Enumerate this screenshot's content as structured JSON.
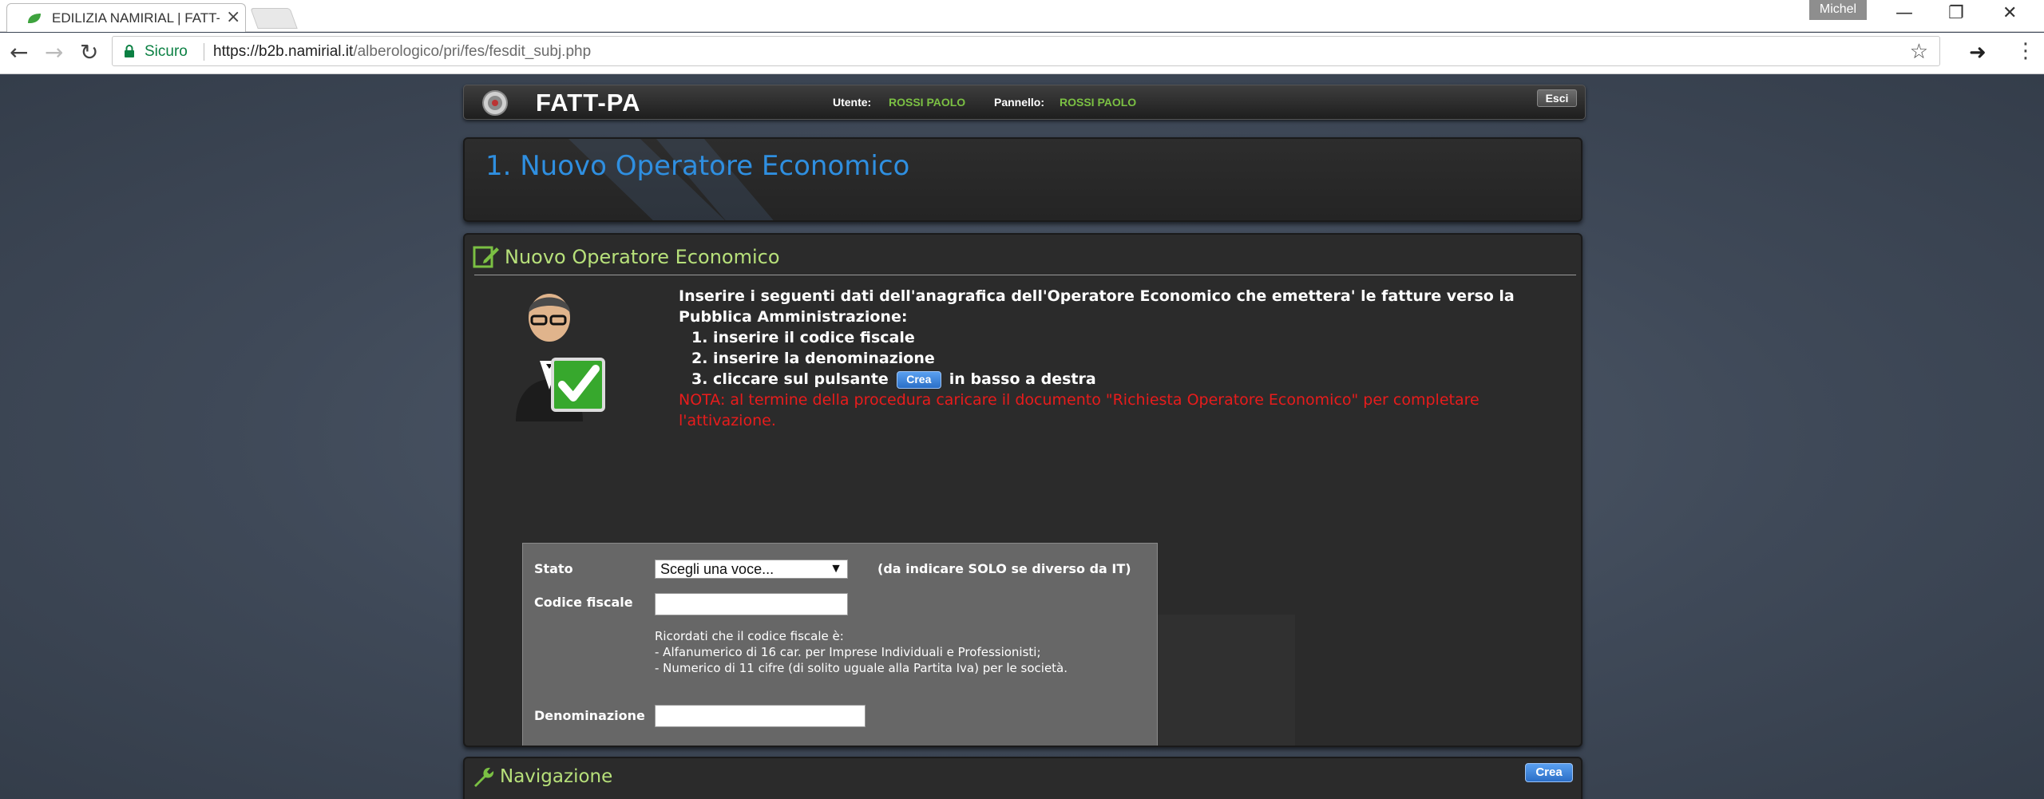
{
  "browser": {
    "tab_title": "EDILIZIA NAMIRIAL | FATT-PA",
    "tab_close": "×",
    "user_badge": "Michel",
    "secure_label": "Sicuro",
    "url_host": "https://b2b.namirial.it",
    "url_path": "/alberologico/pri/fes/fesdit_subj.php",
    "icons": [
      "back-arrow-icon",
      "forward-arrow-icon",
      "reload-icon",
      "lock-icon",
      "star-icon",
      "extension-arrow-icon",
      "menu-dots-icon"
    ]
  },
  "header": {
    "app_title": "FATT-PA",
    "utente_label": "Utente:",
    "utente_value": "ROSSI PAOLO",
    "pannello_label": "Pannello:",
    "pannello_value": "ROSSI PAOLO",
    "esci_label": "Esci"
  },
  "page_title": "1. Nuovo Operatore Economico",
  "main": {
    "section_title": "Nuovo Operatore Economico",
    "intro": "Inserire i seguenti dati dell'anagrafica dell'Operatore Economico che emettera' le fatture verso la Pubblica Amministrazione:",
    "steps": [
      "1. inserire il codice fiscale",
      "2. inserire la denominazione"
    ],
    "step3_pre": "3. cliccare sul pulsante",
    "step3_button": "Crea",
    "step3_post": "in basso a destra",
    "nota": "NOTA: al termine della procedura caricare il documento \"Richiesta Operatore Economico\" per completare l'attivazione."
  },
  "form": {
    "stato_label": "Stato",
    "stato_selected": "Scegli una voce...",
    "stato_note": "(da indicare SOLO se diverso da IT)",
    "codice_label": "Codice fiscale",
    "codice_value": "",
    "help_lines": [
      "Ricordati che il codice fiscale è:",
      "- Alfanumerico di 16 car. per Imprese Individuali e Professionisti;",
      "- Numerico di 11 cifre (di solito uguale alla Partita Iva) per le società."
    ],
    "denominazione_label": "Denominazione",
    "denominazione_value": ""
  },
  "navigation": {
    "title": "Navigazione",
    "crea_label": "Crea"
  },
  "colors": {
    "accent_blue": "#2f8fe0",
    "section_green": "#b7e07a",
    "header_green": "#7bc043",
    "nota_red": "#e81c1c"
  }
}
